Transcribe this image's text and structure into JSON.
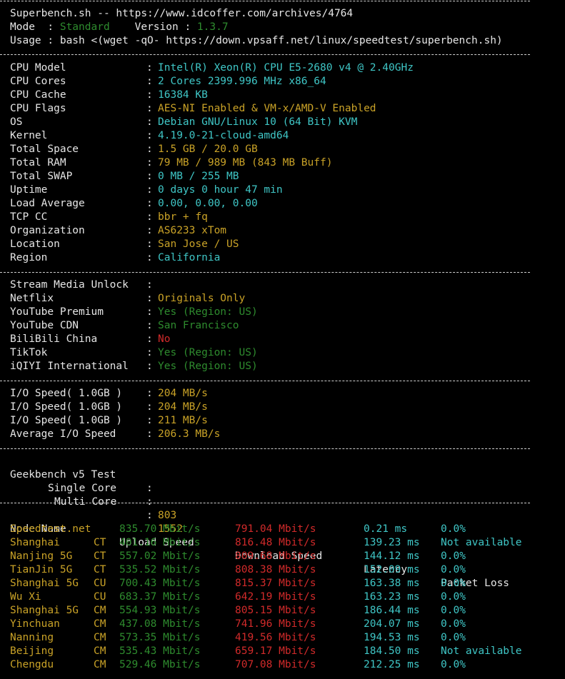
{
  "header": {
    "title_line": "Superbench.sh -- https://www.idcoffer.com/archives/4764",
    "mode_label": "Mode  : ",
    "mode_value": "Standard",
    "version_label": "    Version : ",
    "version_value": "1.3.7",
    "usage_line": "Usage : bash <(wget -qO- https://down.vpsaff.net/linux/speedtest/superbench.sh)"
  },
  "system": [
    {
      "label": "CPU Model",
      "value": "Intel(R) Xeon(R) CPU E5-2680 v4 @ 2.40GHz",
      "color": "cyan"
    },
    {
      "label": "CPU Cores",
      "value": "2 Cores 2399.996 MHz x86_64",
      "color": "cyan"
    },
    {
      "label": "CPU Cache",
      "value": "16384 KB",
      "color": "cyan"
    },
    {
      "label": "CPU Flags",
      "value": "AES-NI Enabled & VM-x/AMD-V Enabled",
      "color": "yellow"
    },
    {
      "label": "OS",
      "value": "Debian GNU/Linux 10 (64 Bit) KVM",
      "color": "cyan"
    },
    {
      "label": "Kernel",
      "value": "4.19.0-21-cloud-amd64",
      "color": "cyan"
    },
    {
      "label": "Total Space",
      "value": "1.5 GB / 20.0 GB",
      "color": "yellow"
    },
    {
      "label": "Total RAM",
      "value": "79 MB / 989 MB (843 MB Buff)",
      "color": "yellow"
    },
    {
      "label": "Total SWAP",
      "value": "0 MB / 255 MB",
      "color": "cyan"
    },
    {
      "label": "Uptime",
      "value": "0 days 0 hour 47 min",
      "color": "cyan"
    },
    {
      "label": "Load Average",
      "value": "0.00, 0.00, 0.00",
      "color": "cyan"
    },
    {
      "label": "TCP CC",
      "value": "bbr + fq",
      "color": "yellow"
    },
    {
      "label": "Organization",
      "value": "AS6233 xTom",
      "color": "yellow"
    },
    {
      "label": "Location",
      "value": "San Jose / US",
      "color": "yellow"
    },
    {
      "label": "Region",
      "value": "California",
      "color": "cyan"
    }
  ],
  "media": [
    {
      "label": "Stream Media Unlock",
      "value": "",
      "color": "white"
    },
    {
      "label": "Netflix",
      "value": "Originals Only",
      "color": "yellow"
    },
    {
      "label": "YouTube Premium",
      "value": "Yes (Region: US)",
      "color": "green"
    },
    {
      "label": "YouTube CDN",
      "value": "San Francisco",
      "color": "green"
    },
    {
      "label": "BiliBili China",
      "value": "No",
      "color": "red"
    },
    {
      "label": "TikTok",
      "value": "Yes (Region: US)",
      "color": "green"
    },
    {
      "label": "iQIYI International",
      "value": "Yes (Region: US)",
      "color": "green"
    }
  ],
  "io": [
    {
      "label": "I/O Speed( 1.0GB )",
      "value": "204 MB/s",
      "color": "yellow"
    },
    {
      "label": "I/O Speed( 1.0GB )",
      "value": "204 MB/s",
      "color": "yellow"
    },
    {
      "label": "I/O Speed( 1.0GB )",
      "value": "211 MB/s",
      "color": "yellow"
    },
    {
      "label": "Average I/O Speed",
      "value": "206.3 MB/s",
      "color": "yellow"
    }
  ],
  "geekbench": {
    "title": "Geekbench v5 Test",
    "single_label": "Single Core",
    "single_value": "803",
    "multi_label": "Multi Core",
    "multi_value": "1552"
  },
  "speedtest": {
    "headers": {
      "node": "Node Name",
      "upload": "Upload Speed",
      "download": "Download Speed",
      "latency": "Latency",
      "loss": "Packet Loss"
    },
    "rows": [
      {
        "node": "Speedtest.net",
        "isp": "",
        "upload": "835.70 Mbit/s",
        "download": "791.04 Mbit/s",
        "latency": "0.21 ms",
        "loss": "0.0%"
      },
      {
        "node": "Shanghai",
        "isp": "CT",
        "upload": "401.16 Mbit/s",
        "download": "816.48 Mbit/s",
        "latency": "139.23 ms",
        "loss": "Not available"
      },
      {
        "node": "Nanjing 5G",
        "isp": "CT",
        "upload": "557.02 Mbit/s",
        "download": "809.68 Mbit/s",
        "latency": "144.12 ms",
        "loss": "0.0%"
      },
      {
        "node": "TianJin 5G",
        "isp": "CT",
        "upload": "535.52 Mbit/s",
        "download": "808.38 Mbit/s",
        "latency": "152.09 ms",
        "loss": "0.0%"
      },
      {
        "node": "Shanghai 5G",
        "isp": "CU",
        "upload": "700.43 Mbit/s",
        "download": "815.37 Mbit/s",
        "latency": "163.38 ms",
        "loss": "0.0%"
      },
      {
        "node": "Wu Xi",
        "isp": "CU",
        "upload": "683.37 Mbit/s",
        "download": "642.19 Mbit/s",
        "latency": "163.23 ms",
        "loss": "0.0%"
      },
      {
        "node": "Shanghai 5G",
        "isp": "CM",
        "upload": "554.93 Mbit/s",
        "download": "805.15 Mbit/s",
        "latency": "186.44 ms",
        "loss": "0.0%"
      },
      {
        "node": "Yinchuan",
        "isp": "CM",
        "upload": "437.08 Mbit/s",
        "download": "741.96 Mbit/s",
        "latency": "204.07 ms",
        "loss": "0.0%"
      },
      {
        "node": "Nanning",
        "isp": "CM",
        "upload": "573.35 Mbit/s",
        "download": "419.56 Mbit/s",
        "latency": "194.53 ms",
        "loss": "0.0%"
      },
      {
        "node": "Beijing",
        "isp": "CM",
        "upload": "535.43 Mbit/s",
        "download": "659.17 Mbit/s",
        "latency": "184.50 ms",
        "loss": "Not available"
      },
      {
        "node": "Chengdu",
        "isp": "CM",
        "upload": "529.46 Mbit/s",
        "download": "707.08 Mbit/s",
        "latency": "212.25 ms",
        "loss": "0.0%"
      }
    ]
  },
  "colors": {
    "background": "#000000",
    "text": "#e6e6e6",
    "cyan": "#3fc6c6",
    "yellow": "#c9a227",
    "green": "#2e8b2e",
    "red": "#d12a2a"
  }
}
